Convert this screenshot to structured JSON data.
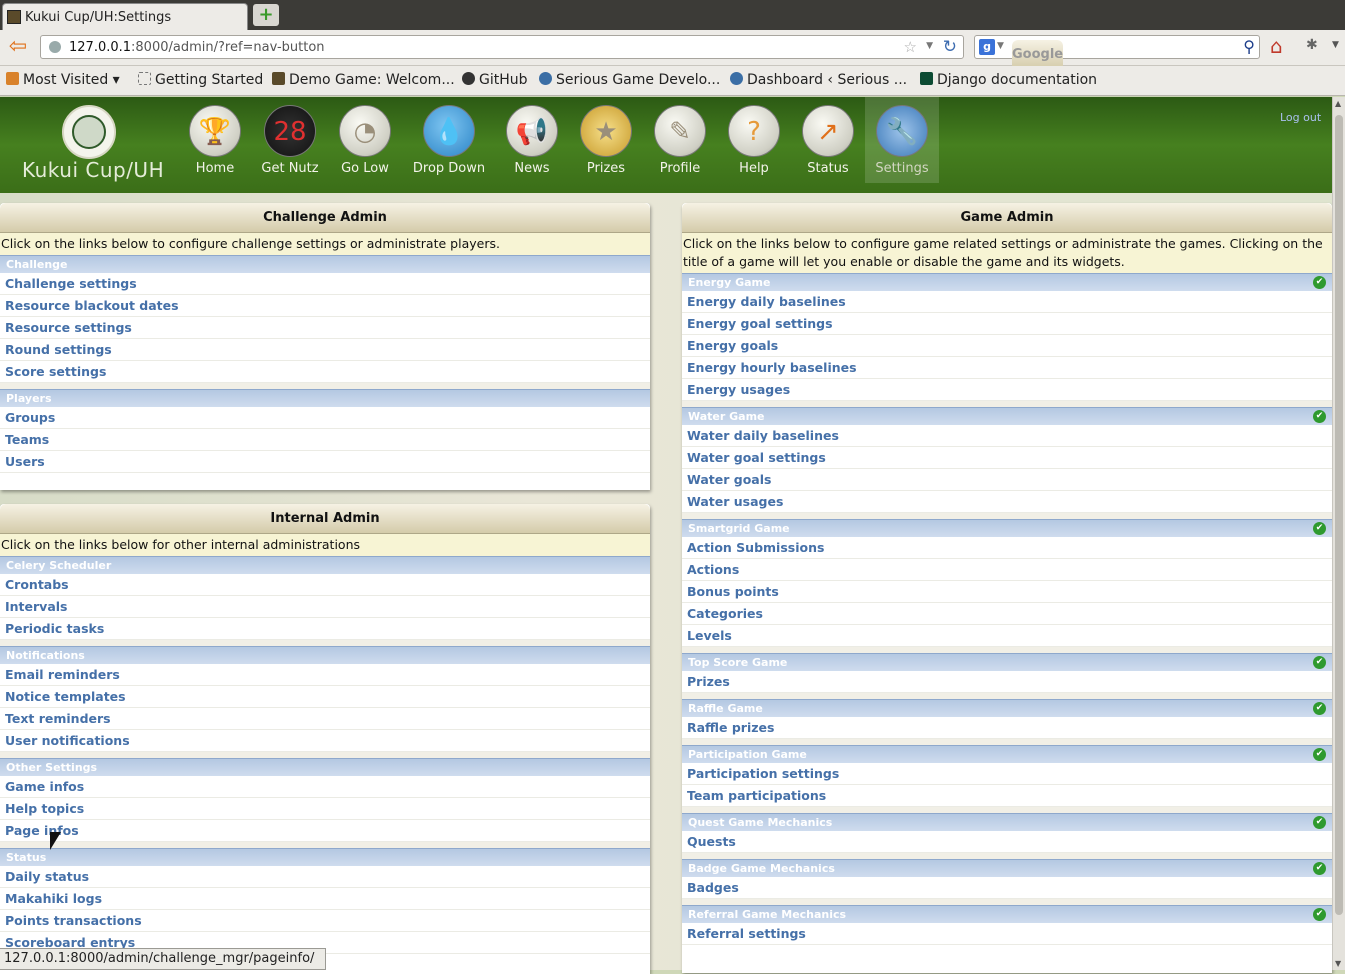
{
  "browser": {
    "tab_title": "Kukui Cup/UH:Settings",
    "url_host": "127.0.0.1",
    "url_rest": ":8000/admin/?ref=nav-button",
    "search_placeholder": "Google",
    "status_url": "127.0.0.1:8000/admin/challenge_mgr/pageinfo/",
    "bookmarks": [
      "Most Visited ▾",
      "Getting Started",
      "Demo Game: Welcom...",
      "GitHub",
      "Serious Game Develo...",
      "Dashboard ‹ Serious ...",
      "Django documentation"
    ]
  },
  "site": {
    "brand": "Kukui Cup/UH",
    "logout": "Log out",
    "nav": [
      "Home",
      "Get Nutz",
      "Go Low",
      "Drop Down",
      "News",
      "Prizes",
      "Profile",
      "Help",
      "Status",
      "Settings"
    ],
    "active_nav": "Settings"
  },
  "challenge_admin": {
    "title": "Challenge Admin",
    "desc": "Click on the links below to configure challenge settings or administrate players.",
    "groups": [
      {
        "name": "Challenge",
        "items": [
          "Challenge settings",
          "Resource blackout dates",
          "Resource settings",
          "Round settings",
          "Score settings"
        ]
      },
      {
        "name": "Players",
        "items": [
          "Groups",
          "Teams",
          "Users"
        ]
      }
    ]
  },
  "internal_admin": {
    "title": "Internal Admin",
    "desc": "Click on the links below for other internal administrations",
    "groups": [
      {
        "name": "Celery Scheduler",
        "items": [
          "Crontabs",
          "Intervals",
          "Periodic tasks"
        ]
      },
      {
        "name": "Notifications",
        "items": [
          "Email reminders",
          "Notice templates",
          "Text reminders",
          "User notifications"
        ]
      },
      {
        "name": "Other Settings",
        "items": [
          "Game infos",
          "Help topics",
          "Page infos"
        ]
      },
      {
        "name": "Status",
        "items": [
          "Daily status",
          "Makahiki logs",
          "Points transactions",
          "Scoreboard entrys"
        ]
      }
    ]
  },
  "game_admin": {
    "title": "Game Admin",
    "desc": "Click on the links below to configure game related settings or administrate the games. Clicking on the title of a game will let you enable or disable the game and its widgets.",
    "groups": [
      {
        "name": "Energy Game",
        "enabled": true,
        "items": [
          "Energy daily baselines",
          "Energy goal settings",
          "Energy goals",
          "Energy hourly baselines",
          "Energy usages"
        ]
      },
      {
        "name": "Water Game",
        "enabled": true,
        "items": [
          "Water daily baselines",
          "Water goal settings",
          "Water goals",
          "Water usages"
        ]
      },
      {
        "name": "Smartgrid Game",
        "enabled": true,
        "items": [
          "Action Submissions",
          "Actions",
          "Bonus points",
          "Categories",
          "Levels"
        ]
      },
      {
        "name": "Top Score Game",
        "enabled": true,
        "items": [
          "Prizes"
        ]
      },
      {
        "name": "Raffle Game",
        "enabled": true,
        "items": [
          "Raffle prizes"
        ]
      },
      {
        "name": "Participation Game",
        "enabled": true,
        "items": [
          "Participation settings",
          "Team participations"
        ]
      },
      {
        "name": "Quest Game Mechanics",
        "enabled": true,
        "items": [
          "Quests"
        ]
      },
      {
        "name": "Badge Game Mechanics",
        "enabled": true,
        "items": [
          "Badges"
        ]
      },
      {
        "name": "Referral Game Mechanics",
        "enabled": true,
        "items": [
          "Referral settings"
        ]
      }
    ]
  }
}
